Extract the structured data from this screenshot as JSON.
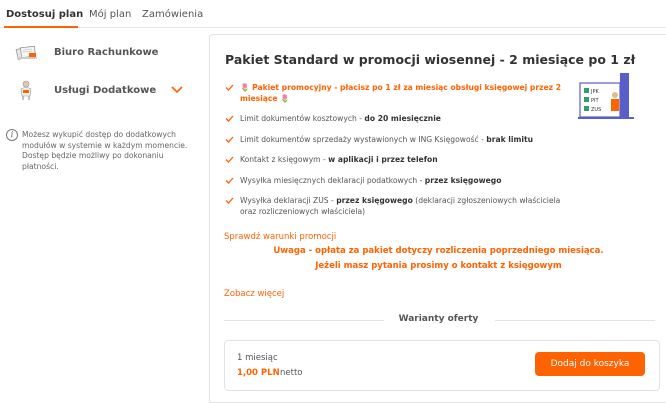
{
  "tabs": [
    {
      "label": "Dostosuj plan",
      "active": true
    },
    {
      "label": "Mój plan",
      "active": false
    },
    {
      "label": "Zamówienia",
      "active": false
    }
  ],
  "sidebar": {
    "items": [
      {
        "label": "Biuro Rachunkowe",
        "icon": "documents-icon"
      },
      {
        "label": "Usługi Dodatkowe",
        "icon": "service-person-icon"
      }
    ],
    "info_text": "Możesz wykupić dostęp do dodatkowych modułów w systemie w każdym momencie. Dostęp będzie możliwy po dokonaniu płatności."
  },
  "plan": {
    "title": "Pakiet Standard w promocji wiosennej - 2 miesiące po 1 zł",
    "features": [
      {
        "prefix": "🌷 Pakiet promocyjny - płacisz po 1 zł za miesiąc obsługi księgowej przez 2 miesiące 🌷",
        "bold": "",
        "suffix": ""
      },
      {
        "prefix": "Limit dokumentów kosztowych - ",
        "bold": "do 20 miesięcznie",
        "suffix": ""
      },
      {
        "prefix": "Limit dokumentów sprzedaży wystawionych w ING Księgowość - ",
        "bold": "brak limitu",
        "suffix": ""
      },
      {
        "prefix": "Kontakt z księgowym - ",
        "bold": "w aplikacji i przez telefon",
        "suffix": ""
      },
      {
        "prefix": "Wysyłka miesięcznych deklaracji podatkowych - ",
        "bold": "przez księgowego",
        "suffix": ""
      },
      {
        "prefix": "Wysyłka deklaracji ZUS - ",
        "bold": "przez księgowego",
        "suffix": " (deklaracji zgłoszeniowych właściciela oraz rozliczeniowych właściciela)"
      }
    ],
    "illustration_labels": [
      "JPK",
      "PIT",
      "ZUS"
    ],
    "promo_link": "Sprawdź warunki promocji",
    "warning_line1": "Uwaga - opłata za pakiet dotyczy rozliczenia poprzedniego miesiąca.",
    "warning_line2": "Jeżeli masz pytania prosimy o kontakt z księgowym",
    "more_link": "Zobacz więcej",
    "variants_title": "Warianty oferty",
    "offer": {
      "period": "1 miesiąc",
      "price": "1,00 PLN",
      "price_suffix": "netto",
      "button_label": "Dodaj do koszyka"
    }
  },
  "colors": {
    "accent": "#ff6200",
    "text": "#333333",
    "border": "#e3e3e3"
  }
}
